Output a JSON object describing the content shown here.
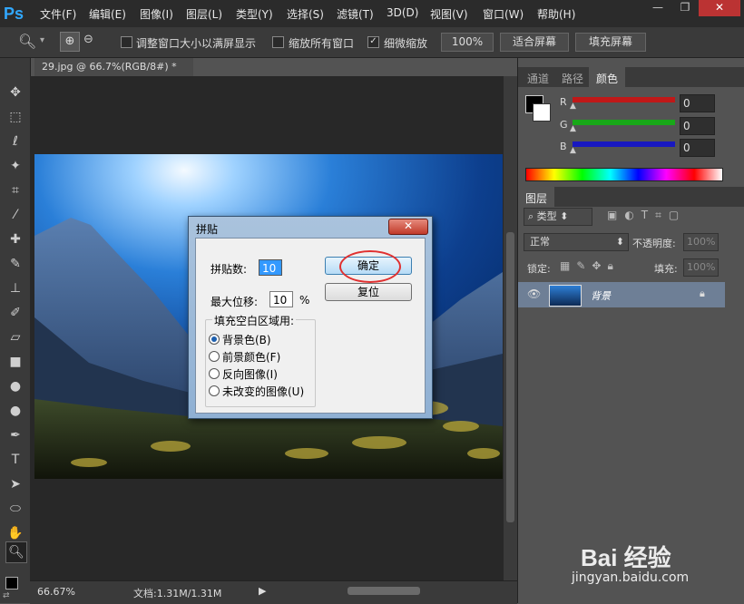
{
  "app": {
    "logo": "Ps"
  },
  "menu": [
    "文件(F)",
    "编辑(E)",
    "图像(I)",
    "图层(L)",
    "类型(Y)",
    "选择(S)",
    "滤镜(T)",
    "3D(D)",
    "视图(V)",
    "窗口(W)",
    "帮助(H)"
  ],
  "window_controls": {
    "minimize": "—",
    "restore": "❐",
    "close": "✕"
  },
  "options_bar": {
    "resize_window_label": "调整窗口大小以满屏显示",
    "resize_window_checked": false,
    "zoom_all_label": "缩放所有窗口",
    "zoom_all_checked": false,
    "scrubby_zoom_label": "细微缩放",
    "scrubby_zoom_checked": true,
    "btn_100": "100%",
    "btn_fit": "适合屏幕",
    "btn_fill": "填充屏幕"
  },
  "document": {
    "tab_title": "29.jpg @ 66.7%(RGB/8#) *",
    "tab_close": "×",
    "status_zoom": "66.67%",
    "status_doc": "文档:1.31M/1.31M"
  },
  "color_panel": {
    "tabs": [
      "通道",
      "路径",
      "颜色"
    ],
    "active_tab": "颜色",
    "channels": [
      {
        "name": "R",
        "value": "0",
        "color": "#c01818"
      },
      {
        "name": "G",
        "value": "0",
        "color": "#18a818"
      },
      {
        "name": "B",
        "value": "0",
        "color": "#1818c0"
      }
    ]
  },
  "layers_panel": {
    "tab": "图层",
    "filter_label": "类型",
    "blend_mode": "正常",
    "opacity_label": "不透明度:",
    "opacity_value": "100%",
    "lock_label": "锁定:",
    "fill_label": "填充:",
    "fill_value": "100%",
    "layers": [
      {
        "name": "背景",
        "visible": true,
        "locked": true
      }
    ]
  },
  "dialog": {
    "title": "拼贴",
    "close": "✕",
    "tiles_label": "拼贴数:",
    "tiles_value": "10",
    "max_offset_label": "最大位移:",
    "max_offset_value": "10",
    "max_offset_unit": "%",
    "ok_label": "确定",
    "reset_label": "复位",
    "fill_group_label": "填充空白区域用:",
    "fill_options": [
      {
        "label": "背景色(B)",
        "selected": true
      },
      {
        "label": "前景颜色(F)",
        "selected": false
      },
      {
        "label": "反向图像(I)",
        "selected": false
      },
      {
        "label": "未改变的图像(U)",
        "selected": false
      }
    ]
  },
  "watermark": {
    "text": "Bai 经验",
    "url": "jingyan.baidu.com"
  }
}
